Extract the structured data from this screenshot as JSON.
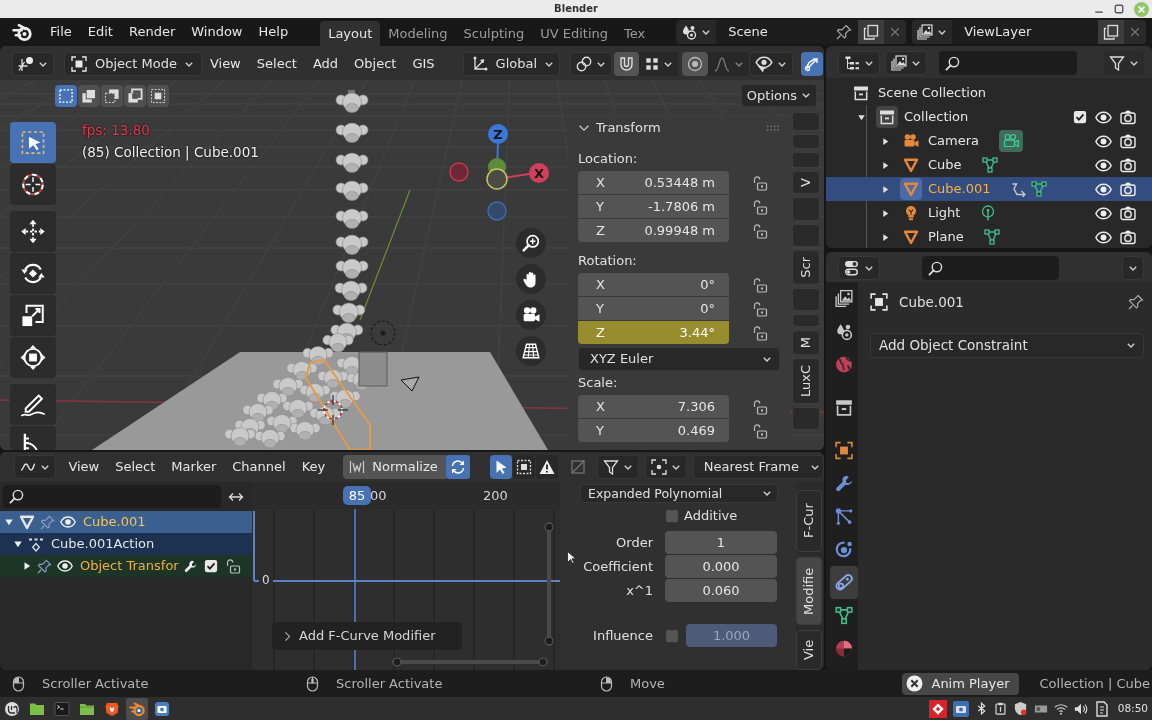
{
  "window": {
    "title": "Blender"
  },
  "menu": [
    "File",
    "Edit",
    "Render",
    "Window",
    "Help"
  ],
  "workspaces": [
    {
      "label": "Layout",
      "selected": true
    },
    {
      "label": "Modeling",
      "selected": false
    },
    {
      "label": "Sculpting",
      "selected": false
    },
    {
      "label": "UV Editing",
      "selected": false
    },
    {
      "label": "Tex",
      "selected": false
    }
  ],
  "scene": {
    "name": "Scene"
  },
  "view_layer": {
    "name": "ViewLayer"
  },
  "viewport": {
    "mode": "Object Mode",
    "menus": [
      "View",
      "Select",
      "Add",
      "Object",
      "GIS"
    ],
    "orientation": "Global",
    "snapping": {
      "on": false
    },
    "proportional_editing": {
      "on": false
    },
    "gizmos": {
      "on": true
    },
    "selection_modes": [
      {
        "kind": "set",
        "selected": true
      },
      {
        "kind": "extend",
        "selected": false
      },
      {
        "kind": "subtract",
        "selected": false
      },
      {
        "kind": "invert",
        "selected": false
      },
      {
        "kind": "intersect",
        "selected": false
      }
    ],
    "options": "Options",
    "fps": "fps: 13.80",
    "info": "(85) Collection | Cube.001",
    "tools": [
      {
        "kind": "select",
        "selected": true
      },
      {
        "kind": "cursor",
        "selected": false
      },
      {
        "kind": "move",
        "selected": false
      },
      {
        "kind": "rotate",
        "selected": false
      },
      {
        "kind": "scale",
        "selected": false
      },
      {
        "kind": "transform",
        "selected": false
      },
      {
        "kind": "annotate",
        "selected": false
      },
      {
        "kind": "measure",
        "selected": false
      }
    ],
    "gizmo_labels": [
      "Z",
      "X"
    ],
    "sidebar_tabs": [
      "V",
      "Scr",
      "M",
      "LuxC"
    ],
    "transform": {
      "title": "Transform",
      "groups": [
        {
          "label": "Location:",
          "fields": [
            {
              "axis": "X",
              "value": "0.53448 m",
              "keyed": false,
              "locked": false
            },
            {
              "axis": "Y",
              "value": "-1.7806 m",
              "keyed": false,
              "locked": false
            },
            {
              "axis": "Z",
              "value": "0.99948 m",
              "keyed": false,
              "locked": false
            }
          ]
        },
        {
          "label": "Rotation:",
          "fields": [
            {
              "axis": "X",
              "value": "0°",
              "keyed": false,
              "locked": false
            },
            {
              "axis": "Y",
              "value": "0°",
              "keyed": false,
              "locked": false
            },
            {
              "axis": "Z",
              "value": "3.44°",
              "keyed": true,
              "locked": false
            }
          ],
          "mode": "XYZ Euler"
        },
        {
          "label": "Scale:",
          "fields": [
            {
              "axis": "X",
              "value": "7.306",
              "keyed": false,
              "locked": false
            },
            {
              "axis": "Y",
              "value": "0.469",
              "keyed": false,
              "locked": false
            }
          ]
        }
      ]
    }
  },
  "outliner": {
    "tree": [
      {
        "label": "Scene Collection",
        "kind": "scene_collection",
        "children": [
          {
            "label": "Collection",
            "kind": "collection",
            "expanded": true,
            "selected": false,
            "checked": true,
            "visible": true,
            "renderable": true,
            "children": [
              {
                "label": "Camera",
                "kind": "camera",
                "expanded": false,
                "selected": false,
                "constrained": false,
                "visible": true,
                "renderable": true
              },
              {
                "label": "Cube",
                "kind": "mesh",
                "expanded": false,
                "selected": false,
                "constrained": false,
                "visible": true,
                "renderable": true
              },
              {
                "label": "Cube.001",
                "kind": "mesh",
                "expanded": false,
                "selected": true,
                "constrained": true,
                "visible": true,
                "renderable": true
              },
              {
                "label": "Light",
                "kind": "light",
                "expanded": false,
                "selected": false,
                "constrained": false,
                "visible": true,
                "renderable": true
              },
              {
                "label": "Plane",
                "kind": "mesh",
                "expanded": false,
                "selected": false,
                "constrained": false,
                "visible": true,
                "renderable": true
              }
            ]
          }
        ]
      }
    ]
  },
  "properties": {
    "tabs": [
      {
        "kind": "output",
        "selected": false
      },
      {
        "kind": "scene",
        "selected": false
      },
      {
        "kind": "world",
        "selected": false
      },
      {
        "kind": "collection",
        "selected": false
      },
      {
        "kind": "object",
        "selected": false
      },
      {
        "kind": "modifiers",
        "selected": false
      },
      {
        "kind": "particles",
        "selected": false
      },
      {
        "kind": "physics",
        "selected": false
      },
      {
        "kind": "constraints",
        "selected": true
      },
      {
        "kind": "data",
        "selected": false
      },
      {
        "kind": "material",
        "selected": false
      }
    ],
    "object_name": "Cube.001",
    "add_button": "Add Object Constraint"
  },
  "graph_editor": {
    "menus": [
      "View",
      "Select",
      "Marker",
      "Channel",
      "Key"
    ],
    "normalize": {
      "label": "Normalize",
      "on": false
    },
    "auto_normalization": {
      "on": true
    },
    "only_selected": {
      "on": true
    },
    "show_hidden": {
      "on": false
    },
    "only_errors": {
      "on": false
    },
    "snapping": "Nearest Frame",
    "channels": [
      {
        "label": "Cube.001",
        "kind": "object",
        "expanded": true,
        "visible": true,
        "children": [
          {
            "label": "Cube.001Action",
            "kind": "action",
            "expanded": true,
            "children": [
              {
                "label": "Object Transfor",
                "kind": "group",
                "expanded": false,
                "visible": true,
                "checked": true
              }
            ]
          }
        ]
      }
    ],
    "current_frame": "85",
    "frame_labels": [
      "00",
      "200"
    ],
    "value_label": "0",
    "modifier_panel": {
      "label": "Add F-Curve Modifier",
      "expanded": false
    },
    "sidebar": {
      "tabs": [
        {
          "label": "F-Cur",
          "selected": false
        },
        {
          "label": "Modifie",
          "selected": true
        },
        {
          "label": "Vie",
          "selected": false
        }
      ],
      "type": "Expanded Polynomial",
      "additive": {
        "label": "Additive",
        "checked": false
      },
      "fields": [
        {
          "label": "Order",
          "value": "1"
        },
        {
          "label": "Coefficient",
          "value": "0.000"
        },
        {
          "label": "x^1",
          "value": "0.060"
        }
      ],
      "influence": {
        "label": "Influence",
        "checked": false,
        "value": "1.000"
      }
    }
  },
  "status_bar": {
    "hints": [
      {
        "kind": "left_click",
        "label": "Scroller Activate"
      },
      {
        "kind": "middle_click",
        "label": "Scroller Activate"
      },
      {
        "kind": "right_click",
        "label": "Move"
      }
    ],
    "anim_player": "Anim Player",
    "info": "Collection | Cube"
  },
  "taskbar": {
    "apps": [
      {
        "kind": "menu",
        "active": false
      },
      {
        "kind": "desktop",
        "active": false
      },
      {
        "kind": "terminal",
        "active": false
      },
      {
        "kind": "files",
        "active": false
      },
      {
        "kind": "browser",
        "active": false
      },
      {
        "kind": "blender",
        "active": true
      },
      {
        "kind": "screenshot",
        "active": false
      }
    ],
    "clock": "08:50"
  }
}
